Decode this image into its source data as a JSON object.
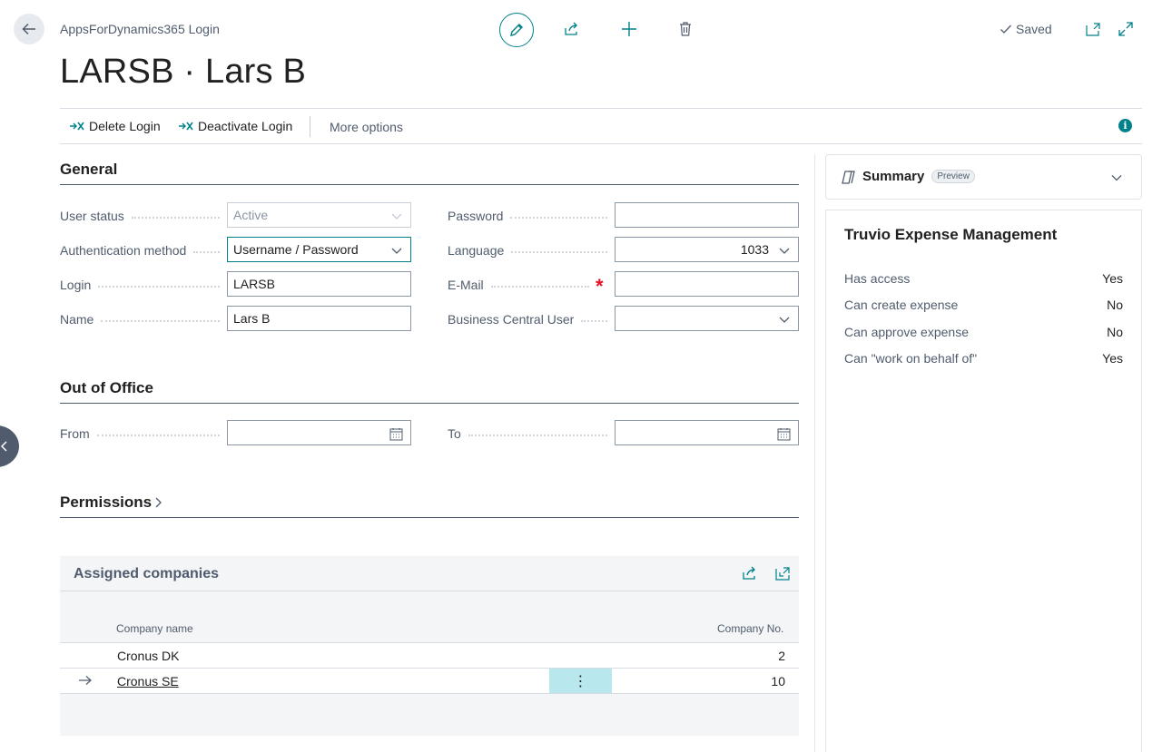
{
  "header": {
    "breadcrumb": "AppsForDynamics365 Login",
    "title": "LARSB · Lars B",
    "saved_label": "Saved"
  },
  "actions": {
    "delete_login": "Delete Login",
    "deactivate_login": "Deactivate Login",
    "more_options": "More options"
  },
  "general": {
    "section_title": "General",
    "user_status_label": "User status",
    "user_status_value": "Active",
    "auth_method_label": "Authentication method",
    "auth_method_value": "Username / Password",
    "login_label": "Login",
    "login_value": "LARSB",
    "name_label": "Name",
    "name_value": "Lars B",
    "password_label": "Password",
    "password_value": "",
    "language_label": "Language",
    "language_value": "1033",
    "email_label": "E-Mail",
    "email_value": "",
    "bc_user_label": "Business Central User",
    "bc_user_value": ""
  },
  "out_of_office": {
    "section_title": "Out of Office",
    "from_label": "From",
    "from_value": "",
    "to_label": "To",
    "to_value": ""
  },
  "permissions": {
    "section_title": "Permissions"
  },
  "assigned_companies": {
    "title": "Assigned companies",
    "columns": [
      "Company name",
      "Company No."
    ],
    "rows": [
      {
        "name": "Cronus DK",
        "no": "2"
      },
      {
        "name": "Cronus SE",
        "no": "10"
      }
    ]
  },
  "factbox": {
    "summary_title": "Summary",
    "preview_badge": "Preview",
    "card_title": "Truvio Expense Management",
    "rows": [
      {
        "label": "Has access",
        "value": "Yes"
      },
      {
        "label": "Can create expense",
        "value": "No"
      },
      {
        "label": "Can approve expense",
        "value": "No"
      },
      {
        "label": "Can \"work on behalf of\"",
        "value": "Yes"
      }
    ]
  },
  "colors": {
    "accent": "#00818a",
    "required": "#e81123",
    "selected_cell": "#b8e8ed"
  }
}
